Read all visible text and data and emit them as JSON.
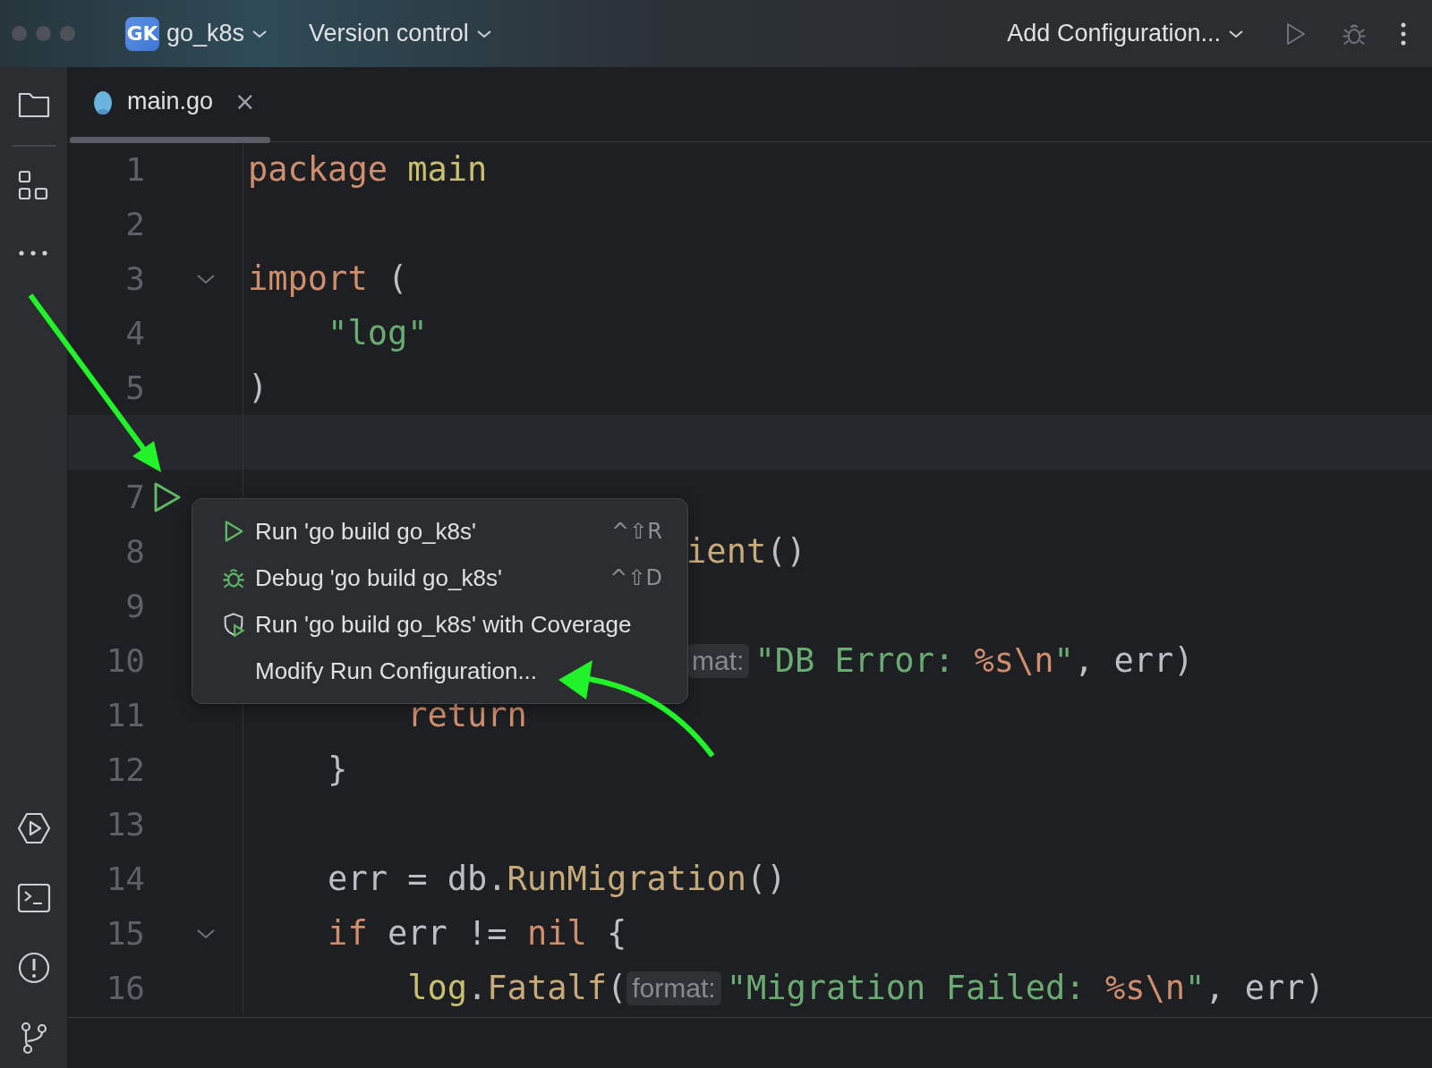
{
  "title_bar": {
    "project_badge": "GK",
    "project": "go_k8s",
    "vcs": "Version control",
    "run_config": "Add Configuration..."
  },
  "tabs": [
    {
      "label": "main.go",
      "selected": true,
      "close": "×"
    }
  ],
  "editor": {
    "lines": [
      {
        "number": "1",
        "current": false,
        "foldable": false,
        "run_marker": false,
        "tokens": [
          {
            "t": "package",
            "kind": "keyword"
          },
          {
            "t": " main",
            "kind": "package"
          }
        ]
      },
      {
        "number": "2",
        "current": false,
        "foldable": false,
        "run_marker": false
      },
      {
        "number": "3",
        "current": false,
        "foldable": true,
        "run_marker": false,
        "tokens": [
          {
            "t": "import",
            "kind": "keyword"
          },
          {
            "t": " (",
            "kind": "plain"
          }
        ]
      },
      {
        "number": "4",
        "current": false,
        "foldable": false,
        "run_marker": false,
        "tokens": [
          {
            "t": "    \"log\"",
            "kind": "string"
          }
        ]
      },
      {
        "number": "5",
        "current": false,
        "foldable": false,
        "run_marker": false,
        "tokens": [
          {
            "t": ")",
            "kind": "plain"
          }
        ]
      },
      {
        "current": true,
        "foldable": false,
        "run_marker": false
      },
      {
        "number": "7",
        "current": false,
        "foldable": false,
        "run_marker": true
      },
      {
        "number": "8",
        "current": false,
        "run_marker": false,
        "tokens": [
          {
            "t": "                      ient",
            "kind": "function"
          },
          {
            "t": "()",
            "kind": "plain"
          }
        ]
      },
      {
        "number": "9",
        "current": false,
        "run_marker": false
      },
      {
        "number": "10",
        "current": false,
        "run_marker": false,
        "tokens": [
          {
            "t": "                      mat:",
            "kind": "hint"
          },
          {
            "t": "\"DB Error: ",
            "kind": "string"
          },
          {
            "t": "%s\\n",
            "kind": "escape"
          },
          {
            "t": "\"",
            "kind": "string"
          },
          {
            "t": ", err)",
            "kind": "plain"
          }
        ]
      },
      {
        "number": "11",
        "current": false,
        "foldable": false,
        "run_marker": false,
        "tokens": [
          {
            "t": "        return",
            "kind": "keyword"
          }
        ]
      },
      {
        "number": "12",
        "current": false,
        "foldable": false,
        "run_marker": false,
        "tokens": [
          {
            "t": "    }",
            "kind": "plain"
          }
        ]
      },
      {
        "number": "13",
        "current": false,
        "foldable": false,
        "run_marker": false
      },
      {
        "number": "14",
        "current": false,
        "foldable": false,
        "run_marker": false,
        "tokens": [
          {
            "t": "    err = db.",
            "kind": "plain"
          },
          {
            "t": "RunMigration",
            "kind": "function"
          },
          {
            "t": "()",
            "kind": "plain"
          }
        ]
      },
      {
        "number": "15",
        "current": false,
        "foldable": true,
        "run_marker": false,
        "tokens": [
          {
            "t": "    if",
            "kind": "keyword"
          },
          {
            "t": " err != ",
            "kind": "plain"
          },
          {
            "t": "nil",
            "kind": "keyword"
          },
          {
            "t": " {",
            "kind": "plain"
          }
        ]
      },
      {
        "number": "16",
        "current": false,
        "foldable": false,
        "run_marker": false,
        "tokens": [
          {
            "t": "        log",
            "kind": "package"
          },
          {
            "t": ".",
            "kind": "plain"
          },
          {
            "t": "Fatalf",
            "kind": "function"
          },
          {
            "t": "(",
            "kind": "plain"
          },
          {
            "t": "format:",
            "kind": "hint"
          },
          {
            "t": "\"Migration Failed: ",
            "kind": "string"
          },
          {
            "t": "%s\\n",
            "kind": "escape"
          },
          {
            "t": "\"",
            "kind": "string"
          },
          {
            "t": ", err)",
            "kind": "plain"
          }
        ]
      }
    ]
  },
  "popup_menu": {
    "items": [
      {
        "kind": "run",
        "label": "Run 'go build go_k8s'",
        "shortcut": "^⇧R"
      },
      {
        "kind": "debug",
        "label": "Debug 'go build go_k8s'",
        "shortcut": "^⇧D"
      },
      {
        "kind": "coverage",
        "label": "Run 'go build go_k8s' with Coverage"
      },
      {
        "kind": "plain",
        "label": "Modify Run Configuration..."
      }
    ]
  }
}
